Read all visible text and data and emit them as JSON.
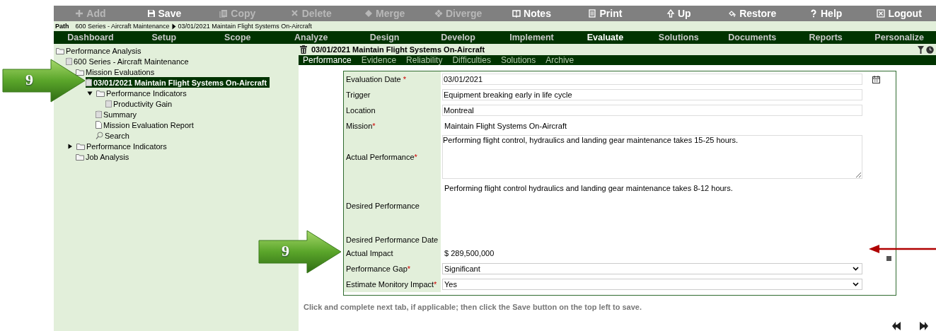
{
  "toolbar": [
    {
      "label": "Add",
      "disabled": true
    },
    {
      "label": "Save",
      "disabled": false
    },
    {
      "label": "Copy",
      "disabled": true
    },
    {
      "label": "Delete",
      "disabled": true
    },
    {
      "label": "Merge",
      "disabled": true
    },
    {
      "label": "Diverge",
      "disabled": true
    },
    {
      "label": "Notes",
      "disabled": false
    },
    {
      "label": "Print",
      "disabled": false
    },
    {
      "label": "Up",
      "disabled": false
    },
    {
      "label": "Restore",
      "disabled": false
    },
    {
      "label": "Help",
      "disabled": false
    },
    {
      "label": "Logout",
      "disabled": false
    }
  ],
  "path": {
    "label": "Path",
    "crumbs": [
      "600 Series - Aircraft Maintenance",
      "03/01/2021 Maintain Flight Systems On-Aircraft"
    ]
  },
  "nav": [
    {
      "label": "Dashboard",
      "selected": false
    },
    {
      "label": "Setup",
      "selected": false
    },
    {
      "label": "Scope",
      "selected": false
    },
    {
      "label": "Analyze",
      "selected": false
    },
    {
      "label": "Design",
      "selected": false
    },
    {
      "label": "Develop",
      "selected": false
    },
    {
      "label": "Implement",
      "selected": false
    },
    {
      "label": "Evaluate",
      "selected": true
    },
    {
      "label": "Solutions",
      "selected": false
    },
    {
      "label": "Documents",
      "selected": false
    },
    {
      "label": "Reports",
      "selected": false
    },
    {
      "label": "Personalize",
      "selected": false
    }
  ],
  "tree": [
    {
      "label": "Performance Analysis",
      "kind": "folder",
      "selected": false,
      "children": [
        {
          "label": "600 Series - Aircraft Maintenance",
          "kind": "record",
          "selected": false,
          "children": [
            {
              "label": "Mission Evaluations",
              "kind": "folder",
              "selected": false,
              "children": [
                {
                  "label": "03/01/2021 Maintain Flight Systems On-Aircraft",
                  "kind": "record",
                  "selected": true,
                  "children": [
                    {
                      "label": "Performance Indicators",
                      "kind": "folder",
                      "selected": false,
                      "expanded": true,
                      "children": [
                        {
                          "label": "Productivity Gain",
                          "kind": "record",
                          "selected": false
                        }
                      ]
                    },
                    {
                      "label": "Summary",
                      "kind": "record",
                      "selected": false
                    },
                    {
                      "label": "Mission Evaluation Report",
                      "kind": "report",
                      "selected": false
                    },
                    {
                      "label": "Search",
                      "kind": "search",
                      "selected": false
                    }
                  ]
                }
              ]
            },
            {
              "label": "Performance Indicators",
              "kind": "folder",
              "selected": false,
              "expanded": false
            },
            {
              "label": "Job Analysis",
              "kind": "folder",
              "selected": false
            }
          ]
        }
      ]
    }
  ],
  "record": {
    "title": "03/01/2021 Maintain Flight Systems On-Aircraft"
  },
  "tabs": [
    {
      "label": "Performance",
      "selected": true
    },
    {
      "label": "Evidence",
      "selected": false
    },
    {
      "label": "Reliability",
      "selected": false
    },
    {
      "label": "Difficulties",
      "selected": false
    },
    {
      "label": "Solutions",
      "selected": false
    },
    {
      "label": "Archive",
      "selected": false
    }
  ],
  "form": [
    {
      "kind": "date",
      "label": "Evaluation Date",
      "required_mark": "*",
      "value": "03/01/2021"
    },
    {
      "kind": "text",
      "label": "Trigger",
      "value": "Equipment breaking early in life cycle"
    },
    {
      "kind": "text",
      "label": "Location",
      "value": "Montreal"
    },
    {
      "kind": "static",
      "label": "Mission",
      "required_mark": "*",
      "value": "Maintain Flight Systems On-Aircraft"
    },
    {
      "kind": "textarea",
      "label": "Actual Performance",
      "required_mark": "*",
      "value": "Performing flight control, hydraulics and landing gear maintenance takes 15-25 hours."
    },
    {
      "kind": "tallstatic",
      "label": "Desired Performance",
      "value": "Performing flight control hydraulics and landing gear maintenance takes 8-12 hours."
    },
    {
      "kind": "blank",
      "label": "Desired Performance Date"
    },
    {
      "kind": "impact",
      "label": "Actual Impact",
      "value": "$ 289,500,000"
    },
    {
      "kind": "select",
      "label": "Performance Gap",
      "required_mark": "*",
      "value": "Significant"
    },
    {
      "kind": "select",
      "label": "Estimate Monitory Impact",
      "required_mark": "*",
      "value": "Yes"
    }
  ],
  "note": "Click and complete next tab, if applicable; then click the Save button on the top left to save.",
  "callouts": [
    {
      "number": "9"
    },
    {
      "number": "9"
    }
  ]
}
